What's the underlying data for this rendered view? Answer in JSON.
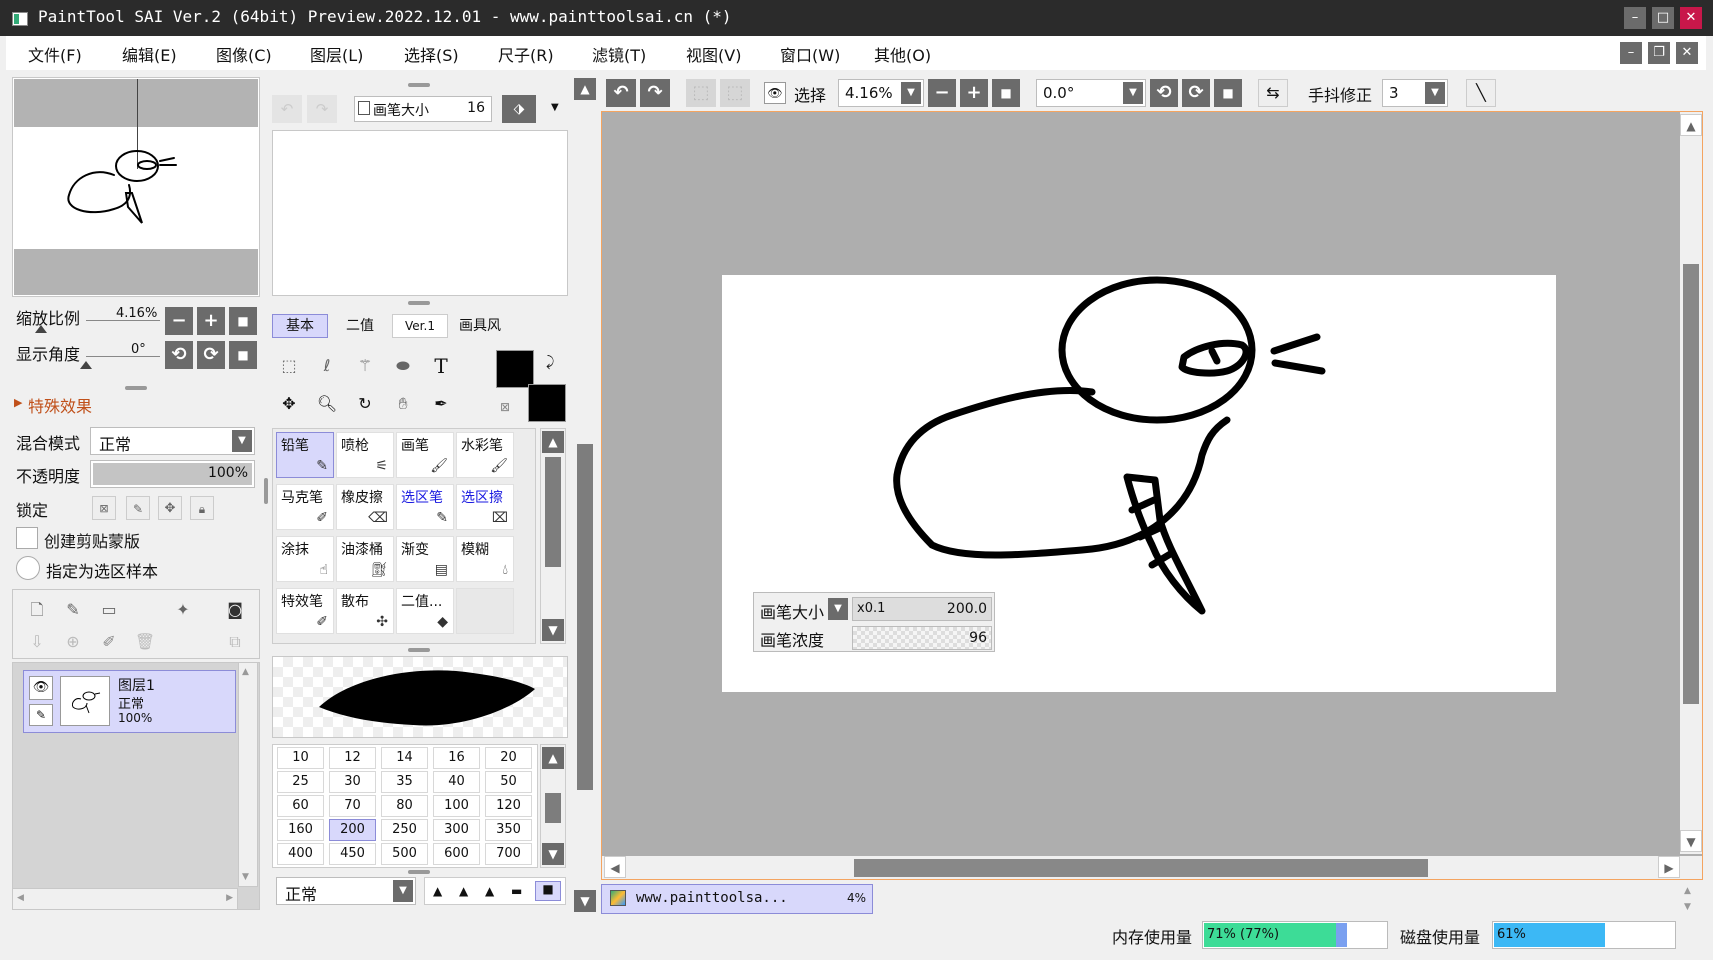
{
  "window": {
    "title": "PaintTool SAI Ver.2 (64bit) Preview.2022.12.01 - www.painttoolsai.cn (*)"
  },
  "menu": [
    "文件(F)",
    "编辑(E)",
    "图像(C)",
    "图层(L)",
    "选择(S)",
    "尺子(R)",
    "滤镜(T)",
    "视图(V)",
    "窗口(W)",
    "其他(O)"
  ],
  "navigator": {
    "zoom_label": "缩放比例",
    "zoom_value": "4.16%",
    "angle_label": "显示角度",
    "angle_value": "0°"
  },
  "effects": {
    "label": "特殊效果"
  },
  "layer_props": {
    "blend_label": "混合模式",
    "blend_value": "正常",
    "opacity_label": "不透明度",
    "opacity_value": "100%",
    "opacity_fraction": 1.0,
    "lock_label": "锁定",
    "clip_label": "创建剪贴蒙版",
    "sample_label": "指定为选区样本"
  },
  "layers": [
    {
      "name": "图层1",
      "mode": "正常",
      "opacity": "100%"
    }
  ],
  "brush_size_box": {
    "label": "画笔大小",
    "value": "16"
  },
  "tool_tabs": [
    "基本",
    "二值",
    "Ver.1",
    "画具风"
  ],
  "tools": [
    {
      "label": "铅笔",
      "icon": "pencil-icon",
      "selected": true
    },
    {
      "label": "喷枪",
      "icon": "airbrush-icon"
    },
    {
      "label": "画笔",
      "icon": "brush-icon"
    },
    {
      "label": "水彩笔",
      "icon": "watercolor-icon"
    },
    {
      "label": "马克笔",
      "icon": "marker-icon"
    },
    {
      "label": "橡皮擦",
      "icon": "eraser-icon"
    },
    {
      "label": "选区笔",
      "icon": "selection-pen-icon",
      "blue": true
    },
    {
      "label": "选区擦",
      "icon": "selection-eraser-icon",
      "blue": true
    },
    {
      "label": "涂抹",
      "icon": "smudge-icon"
    },
    {
      "label": "油漆桶",
      "icon": "bucket-icon"
    },
    {
      "label": "渐变",
      "icon": "gradient-icon"
    },
    {
      "label": "模糊",
      "icon": "blur-icon"
    },
    {
      "label": "特效笔",
      "icon": "effect-pen-icon"
    },
    {
      "label": "散布",
      "icon": "scatter-icon"
    },
    {
      "label": "二值...",
      "icon": "binary-icon"
    },
    {
      "label": "",
      "icon": ""
    }
  ],
  "brush_sizes": [
    "10",
    "12",
    "14",
    "16",
    "20",
    "25",
    "30",
    "35",
    "40",
    "50",
    "60",
    "70",
    "80",
    "100",
    "120",
    "160",
    "200",
    "250",
    "300",
    "350",
    "400",
    "450",
    "500",
    "600",
    "700"
  ],
  "selected_size": "200",
  "blend_bottom": "正常",
  "toolbar": {
    "select_label": "选择",
    "zoom": "4.16%",
    "angle": "0.0°",
    "stabilizer_label": "手抖修正",
    "stabilizer_value": "3"
  },
  "brush_popup": {
    "size_label": "画笔大小",
    "size_mult": "x0.1",
    "size_value": "200.0",
    "density_label": "画笔浓度",
    "density_value": "96"
  },
  "doc_tab": {
    "name": "www.painttoolsa...",
    "zoom": "4%"
  },
  "status": {
    "mem_label": "内存使用量",
    "mem_value": "71% (77%)",
    "mem_fraction": 0.71,
    "mem_fraction_peak": 0.77,
    "disk_label": "磁盘使用量",
    "disk_value": "61%",
    "disk_fraction": 0.61
  },
  "colors": {
    "accent": "#d8d8fb",
    "mem_bar": "#3ddc97",
    "disk_bar": "#3cb8f5",
    "canvas_border": "#f4a460"
  }
}
